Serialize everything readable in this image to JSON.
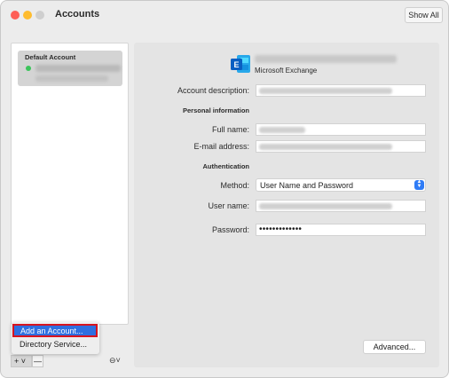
{
  "window": {
    "title": "Accounts",
    "show_all": "Show All"
  },
  "sidebar": {
    "account_title": "Default Account",
    "status_color": "#3cc45b"
  },
  "account": {
    "type_label": "Microsoft Exchange",
    "labels": {
      "description": "Account description:",
      "personal_info": "Personal information",
      "full_name": "Full name:",
      "email": "E-mail address:",
      "authentication": "Authentication",
      "method": "Method:",
      "user_name": "User name:",
      "password": "Password:"
    },
    "method_value": "User Name and Password",
    "password_value": "•••••••••••••",
    "advanced_button": "Advanced..."
  },
  "menu": {
    "add_account": "Add an Account...",
    "directory_service": "Directory Service..."
  },
  "bottombar": {
    "plus": "+ ˅",
    "minus": "—",
    "more": "⊖˅"
  },
  "colors": {
    "accent": "#2f6fe0",
    "highlight_border": "#d7141f",
    "exchange_blue": "#0a5fc2"
  }
}
